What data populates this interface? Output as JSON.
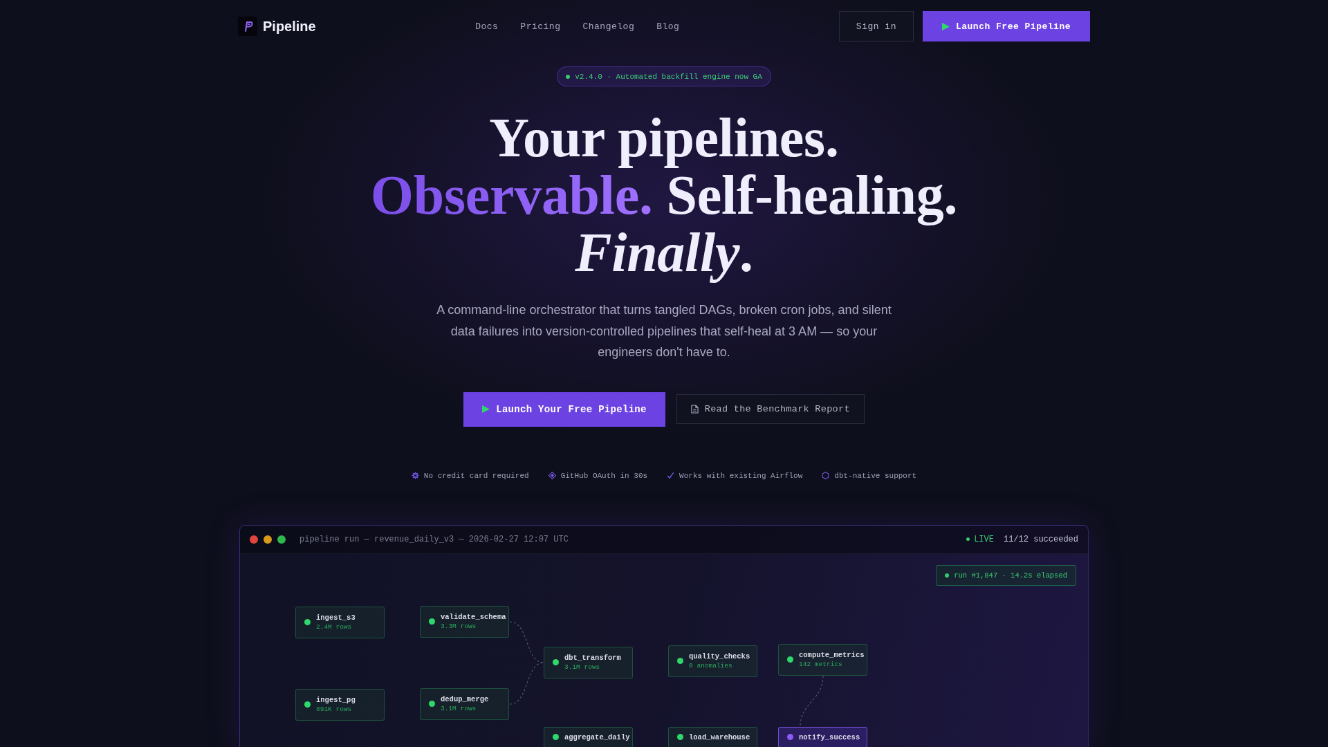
{
  "nav": {
    "brand": "Pipeline",
    "links": [
      "Docs",
      "Pricing",
      "Changelog",
      "Blog"
    ],
    "sign_in": "Sign in",
    "cta": "Launch Free Pipeline"
  },
  "hero": {
    "badge": "v2.4.0 · Automated backfill engine now GA",
    "heading": [
      [
        {
          "text": "Your pipelines.",
          "accent": false
        }
      ],
      [
        {
          "text": "Observable.",
          "accent": true
        },
        {
          "text": "Self-healing.",
          "accent": false
        }
      ],
      [
        {
          "text": "*Finally*.",
          "accent": false
        }
      ]
    ],
    "subtitle": "A command-line orchestrator that turns tangled DAGs, broken cron jobs, and silent data failures into version-controlled pipelines that self-heal at 3 AM — so your engineers don't have to.",
    "primary_button": "Launch Your Free Pipeline",
    "secondary_button": "Read the Benchmark Report",
    "features": [
      "No credit card required",
      "GitHub OAuth in 30s",
      "Works with existing Airflow",
      "dbt-native support"
    ]
  },
  "run_window": {
    "title": "pipeline run — revenue_daily_v3 — 2026-02-27 12:07 UTC",
    "live": "LIVE",
    "summary": "11/12 succeeded",
    "run_badge": "run #1,847 · 14.2s elapsed",
    "nodes": [
      {
        "name": "ingest_s3",
        "detail": "2.4M rows",
        "running": false
      },
      {
        "name": "validate_schema",
        "detail": "3.3M rows",
        "running": false
      },
      {
        "name": "dbt_transform",
        "detail": "3.1M rows",
        "running": false
      },
      {
        "name": "quality_checks",
        "detail": "0 anomalies",
        "running": false
      },
      {
        "name": "compute_metrics",
        "detail": "142 metrics",
        "running": false
      },
      {
        "name": "ingest_pg",
        "detail": "891K rows",
        "running": false
      },
      {
        "name": "dedup_merge",
        "detail": "3.1M rows",
        "running": false
      },
      {
        "name": "aggregate_daily",
        "running": false
      },
      {
        "name": "load_warehouse",
        "running": false
      },
      {
        "name": "notify_success",
        "running": true
      }
    ]
  }
}
